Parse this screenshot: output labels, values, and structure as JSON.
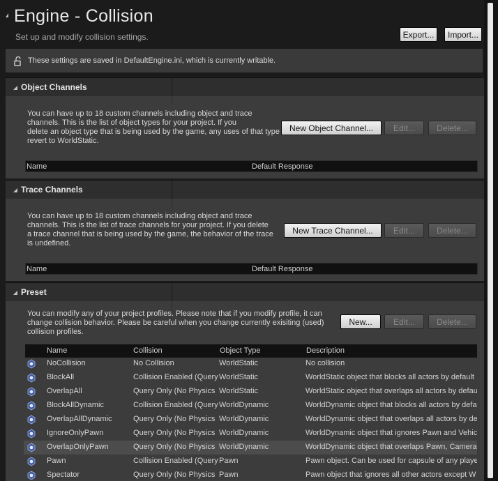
{
  "header": {
    "title": "Engine - Collision",
    "subtitle": "Set up and modify collision settings.",
    "export_label": "Export...",
    "import_label": "Import..."
  },
  "notice": {
    "text": "These settings are saved in DefaultEngine.ini, which is currently writable.",
    "icon": "unlock-icon"
  },
  "object_channels": {
    "title": "Object Channels",
    "description": [
      "You can have up to 18 custom channels including object and trace",
      "channels. This is the list of object types for your project. If you",
      "delete an object type that is being used by the game, any uses of that type will",
      "revert to WorldStatic."
    ],
    "new_label": "New Object Channel...",
    "edit_label": "Edit...",
    "delete_label": "Delete...",
    "columns": [
      "Name",
      "Default Response"
    ]
  },
  "trace_channels": {
    "title": "Trace Channels",
    "description": [
      "You can have up to 18 custom channels including object and trace",
      "channels. This is the list of trace channels for your project. If you delete",
      "a trace channel that is being used by the game, the behavior of the trace",
      "is undefined."
    ],
    "new_label": "New Trace Channel...",
    "edit_label": "Edit...",
    "delete_label": "Delete...",
    "columns": [
      "Name",
      "Default Response"
    ]
  },
  "preset": {
    "title": "Preset",
    "description": [
      "You can modify any of your project profiles. Please note that if you modify profile, it can",
      "change collision behavior. Please be careful when you change currently exisiting (used)",
      "collision profiles."
    ],
    "new_label": "New...",
    "edit_label": "Edit...",
    "delete_label": "Delete...",
    "columns": [
      "Name",
      "Collision",
      "Object Type",
      "Description"
    ],
    "rows": [
      {
        "name": "NoCollision",
        "collision": "No Collision",
        "object_type": "WorldStatic",
        "description": "No collision"
      },
      {
        "name": "BlockAll",
        "collision": "Collision Enabled (Query",
        "object_type": "WorldStatic",
        "description": "WorldStatic object that blocks all actors by default"
      },
      {
        "name": "OverlapAll",
        "collision": "Query Only (No Physics",
        "object_type": "WorldStatic",
        "description": "WorldStatic object that overlaps all actors by default"
      },
      {
        "name": "BlockAllDynamic",
        "collision": "Collision Enabled (Query",
        "object_type": "WorldDynamic",
        "description": "WorldDynamic object that blocks all actors by default"
      },
      {
        "name": "OverlapAllDynamic",
        "collision": "Query Only (No Physics",
        "object_type": "WorldDynamic",
        "description": "WorldDynamic object that overlaps all actors by default"
      },
      {
        "name": "IgnoreOnlyPawn",
        "collision": "Query Only (No Physics",
        "object_type": "WorldDynamic",
        "description": "WorldDynamic object that ignores Pawn and Vehicle"
      },
      {
        "name": "OverlapOnlyPawn",
        "collision": "Query Only (No Physics",
        "object_type": "WorldDynamic",
        "description": "WorldDynamic object that overlaps Pawn, Camera"
      },
      {
        "name": "Pawn",
        "collision": "Collision Enabled (Query",
        "object_type": "Pawn",
        "description": "Pawn object. Can be used for capsule of any player"
      },
      {
        "name": "Spectator",
        "collision": "Query Only (No Physics",
        "object_type": "Pawn",
        "description": "Pawn object that ignores all other actors except W"
      }
    ],
    "highlighted_row": "OverlapOnlyPawn"
  }
}
